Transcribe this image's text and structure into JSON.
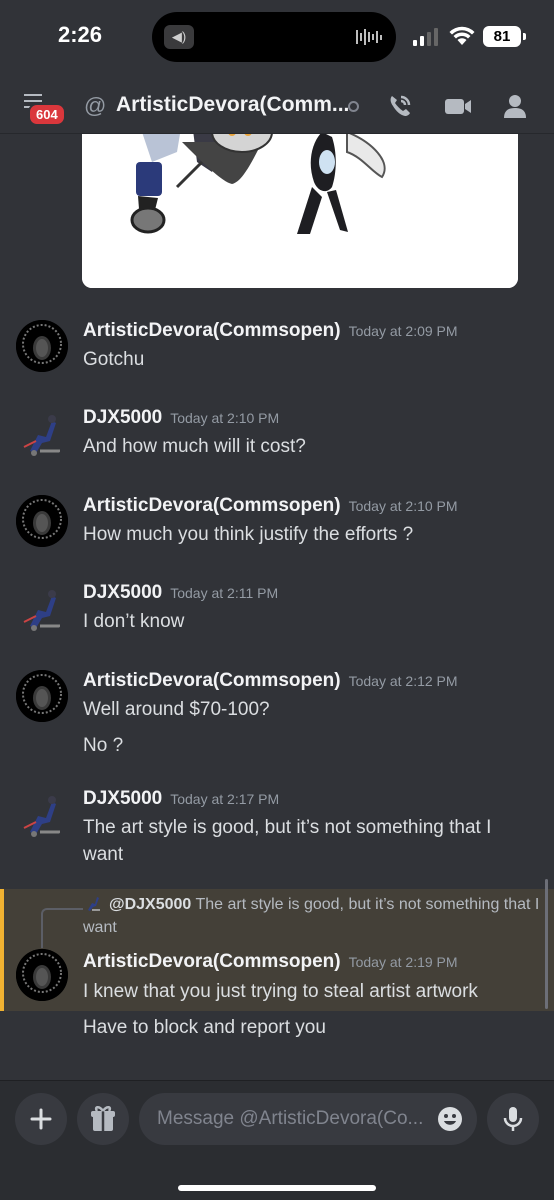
{
  "status_bar": {
    "time": "2:26",
    "battery": "81"
  },
  "header": {
    "unread_count": "604",
    "at_symbol": "@",
    "title": "ArtisticDevora(Comm..."
  },
  "messages": [
    {
      "author": "ArtisticDevora(Commsopen)",
      "timestamp": "Today at 2:09 PM",
      "lines": [
        "Gotchu"
      ]
    },
    {
      "author": "DJX5000",
      "timestamp": "Today at 2:10 PM",
      "lines": [
        "And how much will it cost?"
      ]
    },
    {
      "author": "ArtisticDevora(Commsopen)",
      "timestamp": "Today at 2:10 PM",
      "lines": [
        "How much you think justify the efforts ?"
      ]
    },
    {
      "author": "DJX5000",
      "timestamp": "Today at 2:11 PM",
      "lines": [
        "I don’t know"
      ]
    },
    {
      "author": "ArtisticDevora(Commsopen)",
      "timestamp": "Today at 2:12 PM",
      "lines": [
        "Well around $70-100?",
        "No ?"
      ]
    },
    {
      "author": "DJX5000",
      "timestamp": "Today at 2:17 PM",
      "lines": [
        "The art style is good, but it’s not something that I want"
      ]
    },
    {
      "author": "ArtisticDevora(Commsopen)",
      "timestamp": "Today at 2:19 PM",
      "lines": [
        "I knew that you just trying  to steal artist artwork",
        "Have to block and report you"
      ]
    }
  ],
  "reply": {
    "mention": "@DJX5000",
    "text": "The art style is good, but it’s not something that I want"
  },
  "composer": {
    "placeholder": "Message @ArtisticDevora(Co..."
  },
  "colors": {
    "background": "#313338",
    "highlight": "#444038",
    "highlight_bar": "#f0b232",
    "badge": "#da373c"
  }
}
